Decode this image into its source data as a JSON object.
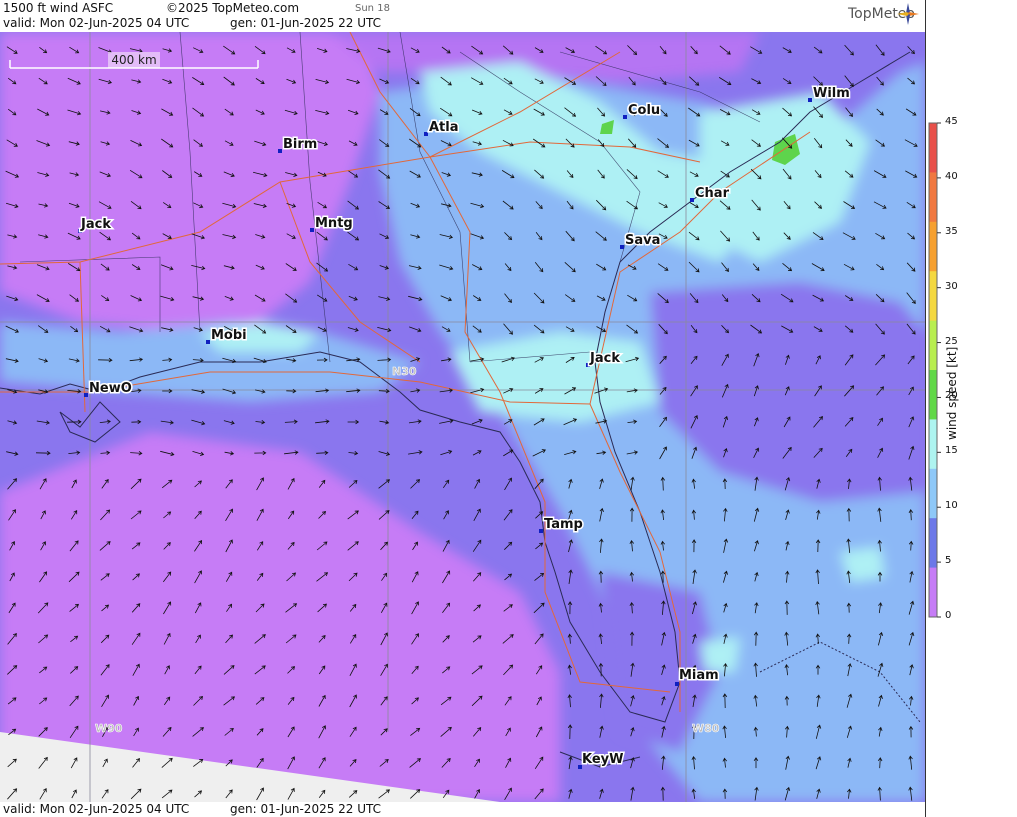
{
  "header": {
    "product": "1500 ft wind ASFC",
    "copyright": "©2025 TopMeteo.com",
    "sun": "Sun 18",
    "valid": "valid:  Mon  02-Jun-2025  04 UTC",
    "generated": "gen: 01-Jun-2025 22 UTC",
    "logo": "TopMeteo"
  },
  "footer": {
    "valid": "valid:  Mon  02-Jun-2025  04 UTC",
    "generated": "gen: 01-Jun-2025 22 UTC"
  },
  "scale_bar": {
    "label": "400 km"
  },
  "cities": [
    {
      "name": "Birm"
    },
    {
      "name": "Atla"
    },
    {
      "name": "Colu"
    },
    {
      "name": "Wilm"
    },
    {
      "name": "Jack"
    },
    {
      "name": "Mntg"
    },
    {
      "name": "Char"
    },
    {
      "name": "Sava"
    },
    {
      "name": "Mobi"
    },
    {
      "name": "Jack"
    },
    {
      "name": "NewO"
    },
    {
      "name": "Tamp"
    },
    {
      "name": "Miam"
    },
    {
      "name": "KeyW"
    }
  ],
  "grid_labels": {
    "n30": "N30",
    "w90": "W90",
    "w80": "W80"
  },
  "colorbar": {
    "title": "wind speed [kt]",
    "ticks": [
      "45",
      "40",
      "35",
      "30",
      "25",
      "20",
      "15",
      "10",
      "5",
      "0"
    ],
    "colors": [
      "#e8504a",
      "#f07840",
      "#f6a030",
      "#f4d840",
      "#f0f050",
      "#b8ee50",
      "#60d848",
      "#aef4f0",
      "#8ec8f8",
      "#6c78e8",
      "#b070f0",
      "#c67cf6"
    ]
  },
  "colors": {
    "speed_0_5": "#c67cf6",
    "speed_5_10": "#8a76ee",
    "speed_10_15": "#8cb8f6",
    "speed_15_20": "#aef0f4",
    "speed_20_25": "#5ed44c",
    "roads": "#e2683a",
    "borders": "#2a2a55"
  }
}
